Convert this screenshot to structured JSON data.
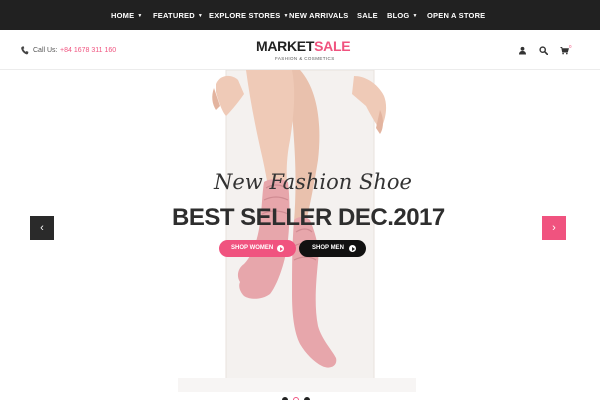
{
  "nav": {
    "items": [
      {
        "label": "HOME",
        "has_caret": true
      },
      {
        "label": "FEATURED",
        "has_caret": true
      },
      {
        "label": "EXPLORE STORES",
        "has_caret": true
      },
      {
        "label": "NEW ARRIVALS",
        "has_caret": false
      },
      {
        "label": "SALE",
        "has_caret": false
      },
      {
        "label": "BLOG",
        "has_caret": true
      },
      {
        "label": "OPEN A STORE",
        "has_caret": false
      }
    ]
  },
  "header": {
    "phone_label": "Call Us:",
    "phone_number": "+84 1678 311 160",
    "logo_part1": "MARKET",
    "logo_part2": "SALE",
    "tagline": "FASHION & COSMETICS",
    "icons": [
      "user-icon",
      "search-icon",
      "cart-icon",
      "phone-icon"
    ],
    "cart_count": "0"
  },
  "slider": {
    "script_title": "New Fashion Shoe",
    "main_title": "BEST SELLER DEC.2017",
    "buttons": {
      "women": "SHOP WOMEN",
      "men": "SHOP MEN"
    },
    "prev_icon": "chevron-left-icon",
    "next_icon": "chevron-right-icon",
    "total_slides": 3,
    "active_slide": 2
  },
  "colors": {
    "accent": "#f0537f",
    "nav_bg": "#212121",
    "dark_button": "#111111",
    "prev_arrow_bg": "#2a2a2a",
    "skin": "#ecc8b4",
    "sock": "#e7a6ab"
  }
}
